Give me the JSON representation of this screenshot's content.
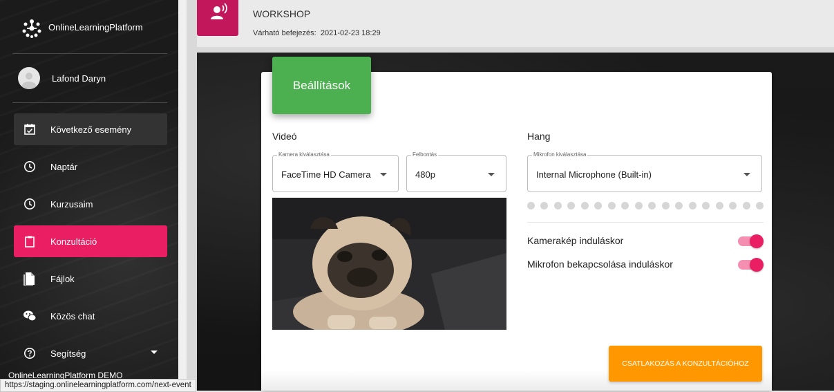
{
  "sidebar": {
    "app_name": "OnlineLearningPlatform",
    "user_name": "Lafond Daryn",
    "items": [
      {
        "label": "Következő esemény",
        "icon": "calendar-check-icon"
      },
      {
        "label": "Naptár",
        "icon": "clock-icon"
      },
      {
        "label": "Kurzusaim",
        "icon": "clock-icon"
      },
      {
        "label": "Konzultáció",
        "icon": "clipboard-icon"
      },
      {
        "label": "Fájlok",
        "icon": "file-icon"
      },
      {
        "label": "Közös chat",
        "icon": "chat-icon"
      },
      {
        "label": "Segítség",
        "icon": "help-icon"
      }
    ],
    "footer": "OnlineLearningPlatform DEMO"
  },
  "status_url": "https://staging.onlinelearningplatform.com/next-event",
  "header": {
    "title": "WORKSHOP",
    "sub_label": "Várható befejezés:",
    "sub_value": "2021-02-23 18:29"
  },
  "modal": {
    "tab_label": "Beállítások",
    "video_title": "Videó",
    "camera": {
      "legend": "Kamera kiválasztása",
      "value": "FaceTime HD Camera"
    },
    "resolution": {
      "legend": "Felbontás",
      "value": "480p"
    },
    "audio_title": "Hang",
    "mic": {
      "legend": "Mikrofon kiválasztása",
      "value": "Internal Microphone (Built-in)"
    },
    "mic_level_dots": 18,
    "options": [
      {
        "label": "Kamerakép induláskor",
        "enabled": true
      },
      {
        "label": "Mikrofon bekapcsolása induláskor",
        "enabled": true
      }
    ],
    "join_button": "CSATLAKOZÁS A KONZULTÁCIÓHOZ"
  },
  "colors": {
    "active_nav": "#e91e63",
    "tab": "#4caf50",
    "join_button": "#ff9800",
    "toggle": "#e91e63",
    "header_icon": "#c2185b"
  }
}
